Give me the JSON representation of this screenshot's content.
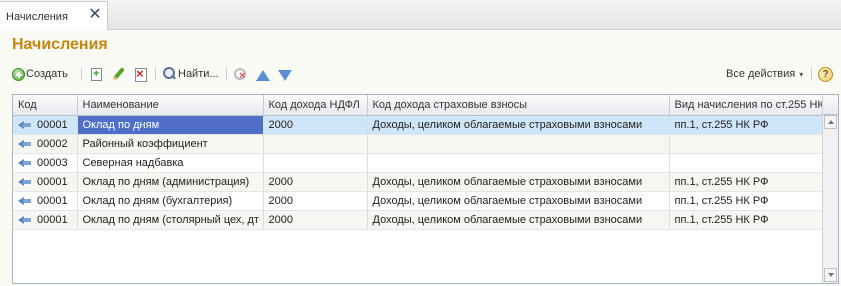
{
  "tab": {
    "label": "Начисления",
    "close": "✕"
  },
  "page": {
    "title": "Начисления"
  },
  "toolbar": {
    "create_label": "Создать",
    "find_label": "Найти...",
    "all_actions_label": "Все действия",
    "all_actions_caret": "▾",
    "help_label": "?"
  },
  "table": {
    "columns": [
      "Код",
      "Наименование",
      "Код дохода НДФЛ",
      "Код дохода страховые взносы",
      "Вид начисления по ст.255 НК"
    ],
    "rows": [
      {
        "code": "00001",
        "name": "Оклад по дням",
        "ndfl": "2000",
        "insurance": "Доходы, целиком облагаемые страховыми взносами",
        "art255": "пп.1, ст.255 НК РФ"
      },
      {
        "code": "00002",
        "name": "Районный коэффициент",
        "ndfl": "",
        "insurance": "",
        "art255": ""
      },
      {
        "code": "00003",
        "name": "Северная надбавка",
        "ndfl": "",
        "insurance": "",
        "art255": ""
      },
      {
        "code": "00001",
        "name": "Оклад по дням (администрация)",
        "ndfl": "2000",
        "insurance": "Доходы, целиком облагаемые страховыми взносами",
        "art255": "пп.1, ст.255 НК РФ"
      },
      {
        "code": "00001",
        "name": "Оклад по дням (бухгалтерия)",
        "ndfl": "2000",
        "insurance": "Доходы, целиком облагаемые страховыми взносами",
        "art255": "пп.1, ст.255 НК РФ"
      },
      {
        "code": "00001",
        "name": "Оклад по дням (столярный цех, дт",
        "ndfl": "2000",
        "insurance": "Доходы, целиком облагаемые страховыми взносами",
        "art255": "пп.1, ст.255 НК РФ"
      }
    ]
  },
  "colors": {
    "title": "#c2860c",
    "selected_cell": "#4f6fc9",
    "current_row": "#cfe6f9"
  }
}
